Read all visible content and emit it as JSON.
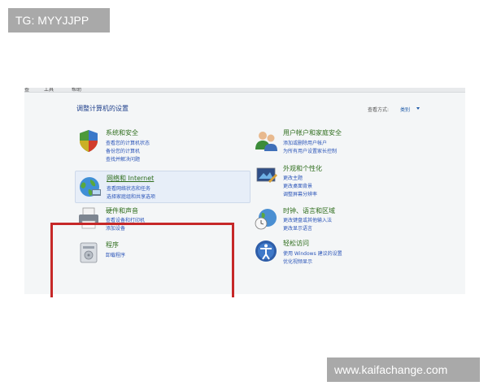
{
  "watermark_top": "TG: MYYJJPP",
  "watermark_bottom": "www.kaifachange.com",
  "menu": [
    "查",
    "工具",
    "帮助"
  ],
  "page_title": "调整计算机的设置",
  "view_by": {
    "label": "查看方式:",
    "value": "类别"
  },
  "categories": [
    {
      "title": "系统和安全",
      "links": [
        "查看您的计算机状态",
        "备份您的计算机",
        "查找并解决问题"
      ]
    },
    {
      "title": "网络和 Internet",
      "links": [
        "查看网络状态和任务",
        "选择家庭组和共享选项"
      ]
    },
    {
      "title": "硬件和声音",
      "links": [
        "查看设备和打印机",
        "添加设备"
      ]
    },
    {
      "title": "程序",
      "links": [
        "卸载程序"
      ]
    },
    {
      "title": "用户帐户和家庭安全",
      "links": [
        "添加或删除用户帐户",
        "为所有用户设置家长控制"
      ]
    },
    {
      "title": "外观和个性化",
      "links": [
        "更改主题",
        "更改桌面背景",
        "调整屏幕分辨率"
      ]
    },
    {
      "title": "时钟、语言和区域",
      "links": [
        "更改键盘或其他输入法",
        "更改显示语言"
      ]
    },
    {
      "title": "轻松访问",
      "links": [
        "使用 Windows 建议的设置",
        "优化视频显示"
      ]
    }
  ],
  "colors": {
    "title_green": "#2e6d1c",
    "link_blue": "#2b55b8",
    "highlight_red": "#c62828"
  }
}
